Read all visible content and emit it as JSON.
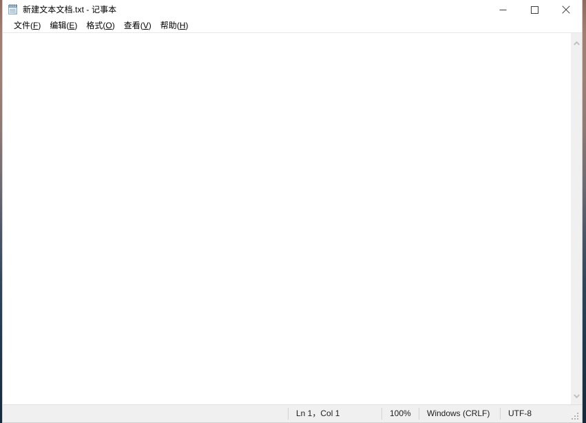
{
  "window": {
    "title": "新建文本文档.txt - 记事本",
    "icon": "notepad-icon",
    "controls": {
      "minimize": "最小化",
      "maximize": "最大化",
      "close": "关闭"
    }
  },
  "menu": {
    "items": [
      {
        "label": "文件(F)",
        "text": "文件(",
        "accel": "F",
        "tail": ")"
      },
      {
        "label": "编辑(E)",
        "text": "编辑(",
        "accel": "E",
        "tail": ")"
      },
      {
        "label": "格式(O)",
        "text": "格式(",
        "accel": "O",
        "tail": ")"
      },
      {
        "label": "查看(V)",
        "text": "查看(",
        "accel": "V",
        "tail": ")"
      },
      {
        "label": "帮助(H)",
        "text": "帮助(",
        "accel": "H",
        "tail": ")"
      }
    ]
  },
  "editor": {
    "content": "",
    "placeholder": ""
  },
  "scrollbar": {
    "up_arrow": "chevron-up-icon",
    "down_arrow": "chevron-down-icon"
  },
  "status_bar": {
    "line_col": "Ln 1，Col 1",
    "zoom": "100%",
    "line_ending": "Windows (CRLF)",
    "encoding": "UTF-8"
  },
  "colors": {
    "window_bg": "#ffffff",
    "status_bg": "#f0f0f0",
    "scrollbar_bg": "#f0f0f0",
    "text": "#000000",
    "separator": "#d2d2d2"
  }
}
